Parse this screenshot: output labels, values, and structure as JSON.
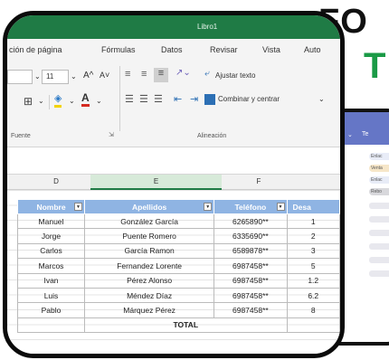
{
  "background": {
    "headline_line1": "FO",
    "headline_line2": "T",
    "side_card": {
      "header_label": "Te",
      "pills": [
        "Enlac",
        "Venta",
        "Enlac",
        "Rebo"
      ],
      "pill_colors": [
        "#e8ecf7",
        "#f6e6c8",
        "#e8ecf7",
        "#d8d8dc"
      ]
    }
  },
  "window": {
    "title": "Libro1",
    "accent_color": "#1f7b45"
  },
  "ribbon_tabs": [
    "ción de página",
    "Fórmulas",
    "Datos",
    "Revisar",
    "Vista",
    "Auto"
  ],
  "ribbon": {
    "font_size_value": "11",
    "grow_font": "A^",
    "shrink_font": "A˅",
    "wrap_text_label": "Ajustar texto",
    "merge_center_label": "Combinar y centrar",
    "font_group_label": "Fuente",
    "alignment_group_label": "Alineación"
  },
  "columns": [
    "D",
    "E",
    "F"
  ],
  "table": {
    "headers": [
      "Nombre",
      "Apellidos",
      "Teléfono",
      "Desa"
    ],
    "rows": [
      [
        "Manuel",
        "González García",
        "6265890**",
        "1"
      ],
      [
        "Jorge",
        "Puente Romero",
        "6335690**",
        "2"
      ],
      [
        "Carlos",
        "García Ramon",
        "6589878**",
        "3"
      ],
      [
        "Marcos",
        "Fernandez Lorente",
        "6987458**",
        "5"
      ],
      [
        "Ivan",
        "Pérez Alonso",
        "6987458**",
        "1.2"
      ],
      [
        "Luis",
        "Méndez Díaz",
        "6987458**",
        "6.2"
      ],
      [
        "Pablo",
        "Márquez Pérez",
        "6987458**",
        "8"
      ]
    ],
    "total_label": "TOTAL"
  }
}
